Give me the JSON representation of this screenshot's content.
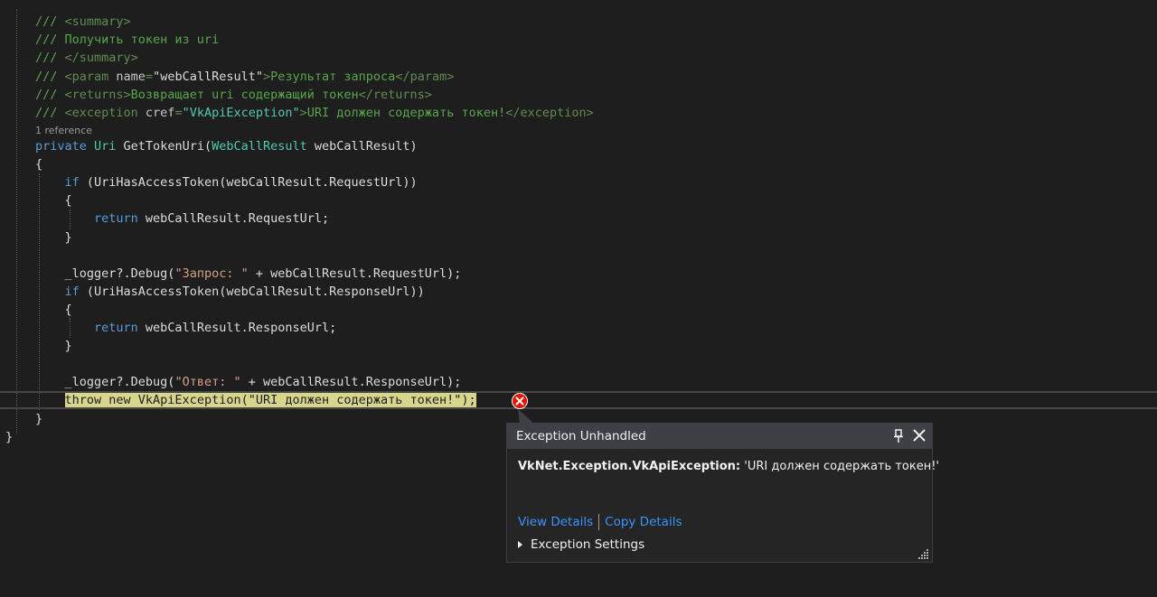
{
  "code": {
    "doc_lines": [
      [
        {
          "c": "com",
          "t": "/// "
        },
        {
          "c": "tag",
          "t": "<summary>"
        }
      ],
      [
        {
          "c": "com",
          "t": "/// Получить токен из uri"
        }
      ],
      [
        {
          "c": "com",
          "t": "/// "
        },
        {
          "c": "tag",
          "t": "</summary>"
        }
      ],
      [
        {
          "c": "com",
          "t": "/// "
        },
        {
          "c": "tag",
          "t": "<param "
        },
        {
          "c": "xmlattr",
          "t": "name"
        },
        {
          "c": "tag",
          "t": "="
        },
        {
          "c": "txt",
          "t": "\"webCallResult\""
        },
        {
          "c": "tag",
          "t": ">"
        },
        {
          "c": "com",
          "t": "Результат запроса"
        },
        {
          "c": "tag",
          "t": "</param>"
        }
      ],
      [
        {
          "c": "com",
          "t": "/// "
        },
        {
          "c": "tag",
          "t": "<returns>"
        },
        {
          "c": "com",
          "t": "Возвращает uri содержащий токен"
        },
        {
          "c": "tag",
          "t": "</returns>"
        }
      ],
      [
        {
          "c": "com",
          "t": "/// "
        },
        {
          "c": "tag",
          "t": "<exception "
        },
        {
          "c": "xmlattr",
          "t": "cref"
        },
        {
          "c": "tag",
          "t": "="
        },
        {
          "c": "cref",
          "t": "\"VkApiException\""
        },
        {
          "c": "tag",
          "t": ">"
        },
        {
          "c": "com",
          "t": "URI должен содержать токен!"
        },
        {
          "c": "tag",
          "t": "</exception>"
        }
      ]
    ],
    "codelens": "1 reference",
    "body_lines": [
      [
        {
          "c": "kw",
          "t": "private "
        },
        {
          "c": "type",
          "t": "Uri"
        },
        {
          "c": "txt",
          "t": " GetTokenUri("
        },
        {
          "c": "type",
          "t": "WebCallResult"
        },
        {
          "c": "txt",
          "t": " webCallResult)"
        }
      ],
      [
        {
          "c": "txt",
          "t": "{"
        }
      ],
      [
        {
          "c": "kw",
          "t": "    if"
        },
        {
          "c": "txt",
          "t": " (UriHasAccessToken(webCallResult.RequestUrl))"
        }
      ],
      [
        {
          "c": "txt",
          "t": "    {"
        }
      ],
      [
        {
          "c": "kw",
          "t": "        return"
        },
        {
          "c": "txt",
          "t": " webCallResult.RequestUrl;"
        }
      ],
      [
        {
          "c": "txt",
          "t": "    }"
        }
      ],
      [
        {
          "c": "txt",
          "t": ""
        }
      ],
      [
        {
          "c": "txt",
          "t": "    _logger?.Debug("
        },
        {
          "c": "str",
          "t": "\"Запрос: \""
        },
        {
          "c": "txt",
          "t": " + webCallResult.RequestUrl);"
        }
      ],
      [
        {
          "c": "kw",
          "t": "    if"
        },
        {
          "c": "txt",
          "t": " (UriHasAccessToken(webCallResult.ResponseUrl))"
        }
      ],
      [
        {
          "c": "txt",
          "t": "    {"
        }
      ],
      [
        {
          "c": "kw",
          "t": "        return"
        },
        {
          "c": "txt",
          "t": " webCallResult.ResponseUrl;"
        }
      ],
      [
        {
          "c": "txt",
          "t": "    }"
        }
      ],
      [
        {
          "c": "txt",
          "t": ""
        }
      ],
      [
        {
          "c": "txt",
          "t": "    _logger?.Debug("
        },
        {
          "c": "str",
          "t": "\"Ответ: \""
        },
        {
          "c": "txt",
          "t": " + webCallResult.ResponseUrl);"
        }
      ],
      [
        {
          "c": "txt",
          "t": "    "
        },
        {
          "c": "hl",
          "t": "throw new VkApiException(\"URI должен содержать токен!\");"
        }
      ],
      [
        {
          "c": "txt",
          "t": "}"
        }
      ]
    ],
    "closing_brace": "}"
  },
  "popup": {
    "title": "Exception Unhandled",
    "exception_type": "VkNet.Exception.VkApiException:",
    "exception_message": " 'URI должен содержать токен!'",
    "view_details": "View Details",
    "copy_details": "Copy Details",
    "settings": "Exception Settings"
  },
  "colors": {
    "background": "#1e1e1e",
    "error_icon": "#e51400",
    "highlight": "#d7d68b",
    "link": "#3794ff"
  }
}
